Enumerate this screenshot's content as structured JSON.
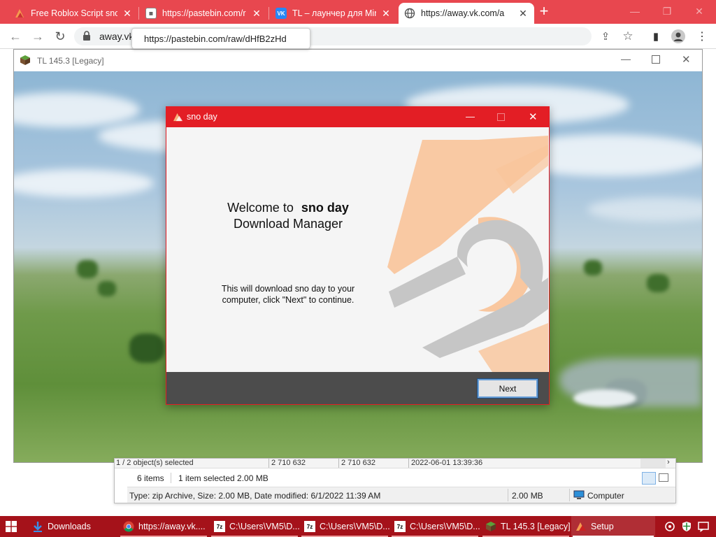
{
  "browser": {
    "tabs": [
      {
        "title": "Free Roblox Script sno",
        "icon": "sno-day-favicon"
      },
      {
        "title": "https://pastebin.com/r",
        "icon": "pastebin-favicon"
      },
      {
        "title": "TL – лаунчер для Mine",
        "icon": "vk-favicon"
      },
      {
        "title": "https://away.vk.com/a",
        "icon": "globe-favicon"
      }
    ],
    "omnibox_text": "away.vk",
    "url_tooltip": "https://pastebin.com/raw/dHfB2zHd",
    "colors": {
      "tabstrip": "#e8474f"
    }
  },
  "launcher": {
    "title": "TL 145.3 [Legacy]"
  },
  "installer": {
    "title": "sno day",
    "welcome_prefix": "Welcome to",
    "product_name": "sno day",
    "subtitle": "Download Manager",
    "instructions_line1": "This will download sno day to your",
    "instructions_line2": "computer, click \"Next\" to continue.",
    "next_label": "Next",
    "colors": {
      "accent": "#e31e25",
      "footer": "#4c4c4c",
      "logo_orange": "#f9c49a",
      "logo_gray": "#c6c6c6"
    }
  },
  "explorer": {
    "columns_row": {
      "selection": "1 / 2 object(s) selected",
      "size1": "2 710 632",
      "size2": "2 710 632",
      "date": "2022-06-01 13:39:36"
    },
    "status": {
      "items": "6 items",
      "selected": "1 item selected  2.00 MB"
    },
    "details": {
      "info": "Type: zip Archive, Size: 2.00 MB, Date modified: 6/1/2022 11:39 AM",
      "size": "2.00 MB",
      "location": "Computer"
    }
  },
  "taskbar": {
    "items": [
      {
        "label": "Downloads",
        "icon": "download-folder-icon"
      },
      {
        "label": "https://away.vk....",
        "icon": "chrome-icon"
      },
      {
        "label": "C:\\Users\\VM5\\D...",
        "icon": "7zip-icon"
      },
      {
        "label": "C:\\Users\\VM5\\D...",
        "icon": "7zip-icon"
      },
      {
        "label": "C:\\Users\\VM5\\D...",
        "icon": "7zip-icon"
      },
      {
        "label": "TL 145.3 [Legacy]",
        "icon": "minecraft-block-icon"
      },
      {
        "label": "Setup",
        "icon": "sno-day-setup-icon"
      }
    ],
    "color": "#a5121a"
  }
}
